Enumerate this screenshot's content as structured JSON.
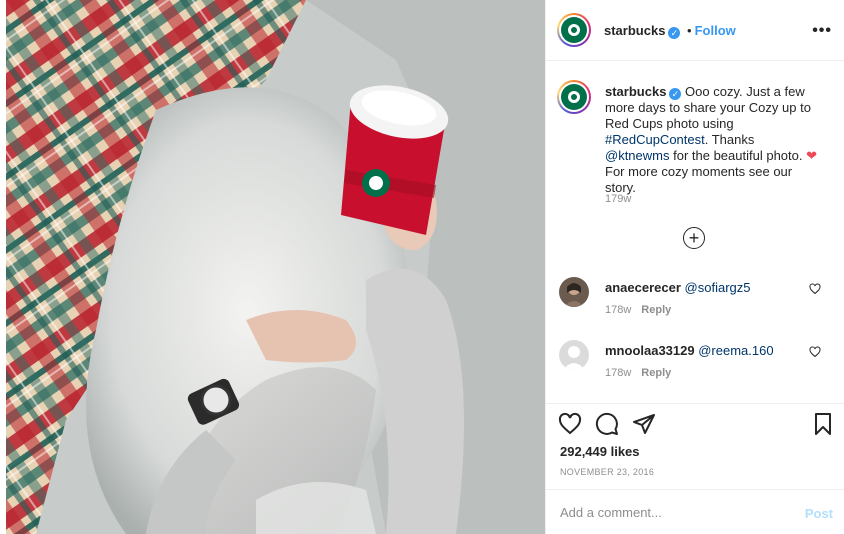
{
  "post": {
    "photo_description": "photo",
    "username": "starbucks",
    "follow_label": "Follow",
    "dot": "•",
    "more_label": "•••"
  },
  "caption": {
    "username": "starbucks",
    "text_part1": "Ooo cozy. Just a few more days to share your Cozy up to Red Cups photo using ",
    "hashtag": "#RedCupContest",
    "text_part2": ". Thanks ",
    "mention": "@ktnewms",
    "text_part3": " for the beautiful photo. ",
    "heart": "❤",
    "text_part4": " For more cozy moments see our story.",
    "time": "179w"
  },
  "comments": [
    {
      "username": "anaecerecer",
      "mention": "@sofiargz5",
      "time": "178w",
      "reply_label": "Reply"
    },
    {
      "username": "mnoolaa33129",
      "mention": "@reema.160",
      "time": "178w",
      "reply_label": "Reply"
    }
  ],
  "engagement": {
    "likes": "292,449 likes",
    "date": "NOVEMBER 23, 2016"
  },
  "comment_box": {
    "placeholder": "Add a comment...",
    "post_label": "Post"
  },
  "colors": {
    "accent": "#3897f0",
    "brand_green": "#00704a",
    "cup_red": "#c8102e"
  }
}
